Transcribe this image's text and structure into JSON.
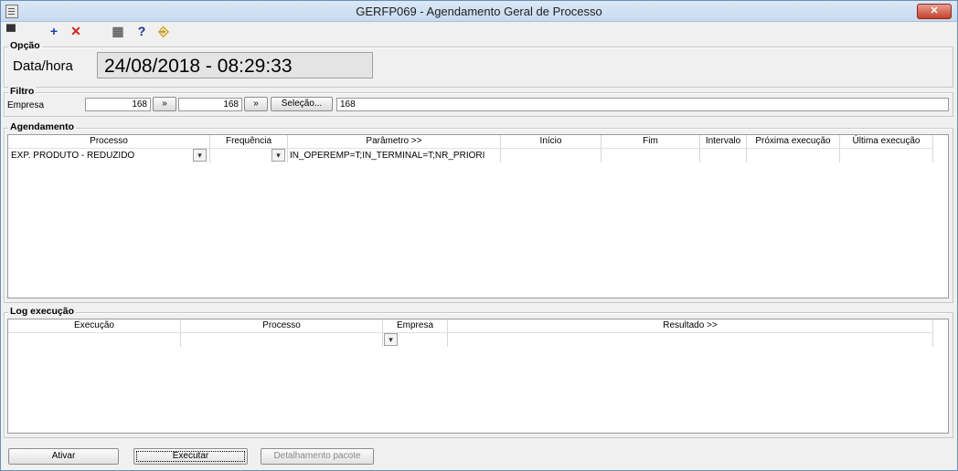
{
  "window": {
    "title": "GERFP069 - Agendamento Geral de Processo",
    "close_glyph": "✕"
  },
  "toolbar": [
    {
      "name": "screen-icon",
      "glyph": "▀",
      "color": "#333333"
    },
    {
      "name": "add-icon",
      "glyph": "+",
      "color": "#1a3fb0"
    },
    {
      "name": "delete-icon",
      "glyph": "✕",
      "color": "#d0201a"
    },
    {
      "name": "calendar-icon",
      "glyph": "▦",
      "color": "#666666"
    },
    {
      "name": "help-icon",
      "glyph": "?",
      "color": "#1a2f8a"
    },
    {
      "name": "exit-icon",
      "glyph": "⎆",
      "color": "#c89a10"
    }
  ],
  "opcao": {
    "label": "Opção",
    "datahora_label": "Data/hora",
    "datahora_value": "24/08/2018  -  08:29:33"
  },
  "filtro": {
    "label": "Filtro",
    "empresa_label": "Empresa",
    "empresa_from": "168",
    "empresa_to": "168",
    "next_label": "»",
    "selecao_label": "Seleção...",
    "selecao_value": "168"
  },
  "agendamento": {
    "label": "Agendamento",
    "columns": [
      "Processo",
      "Frequência",
      "Parâmetro >>",
      "Início",
      "Fim",
      "Intervalo",
      "Próxima execução",
      "Última execução"
    ],
    "rows": [
      {
        "processo": "EXP. PRODUTO - REDUZIDO",
        "frequencia": "",
        "parametro": "IN_OPEREMP=T;IN_TERMINAL=T;NR_PRIORI",
        "inicio": "",
        "fim": "",
        "intervalo": "",
        "proxima": "",
        "ultima": ""
      }
    ]
  },
  "log": {
    "label": "Log execução",
    "columns": [
      "Execução",
      "Processo",
      "Empresa",
      "Resultado >>"
    ]
  },
  "buttons": {
    "ativar": "Ativar",
    "executar": "Executar",
    "detalhamento": "Detalhamento pacote"
  }
}
